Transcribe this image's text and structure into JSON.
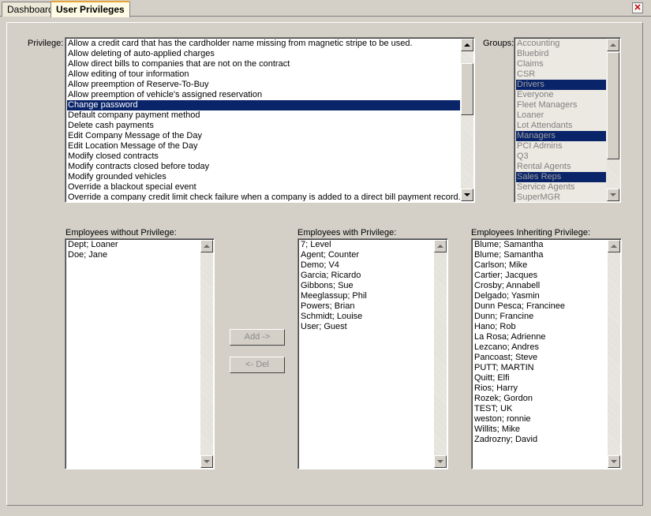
{
  "tabs": [
    {
      "label": "Dashboard",
      "active": false
    },
    {
      "label": "User Privileges",
      "active": true
    }
  ],
  "close_glyph": "✕",
  "privilege": {
    "label": "Privilege:",
    "items": [
      "Allow a credit card that has the cardholder name missing from magnetic stripe to be used.",
      "Allow deleting of auto-applied charges",
      "Allow direct bills to companies that are not on the contract",
      "Allow editing of tour information",
      "Allow preemption of Reserve-To-Buy",
      "Allow preemption of vehicle's assigned reservation",
      "Change password",
      "Default company payment method",
      "Delete cash payments",
      "Edit Company Message of the Day",
      "Edit Location Message of the Day",
      "Modify closed contracts",
      "Modify contracts closed before today",
      "Modify grounded vehicles",
      "Override a blackout special event",
      "Override a company credit limit check failure when a company is added to a direct bill payment record."
    ],
    "selected": "Change password"
  },
  "groups": {
    "label": "Groups:",
    "items": [
      "Accounting",
      "Bluebird",
      "Claims",
      "CSR",
      "Drivers",
      "Everyone",
      "Fleet Managers",
      "Loaner",
      "Lot Attendants",
      "Managers",
      "PCI Admins",
      "Q3",
      "Rental Agents",
      "Sales Reps",
      "Service Agents",
      "SuperMGR"
    ],
    "selected": [
      "Drivers",
      "Managers",
      "Sales Reps"
    ]
  },
  "without": {
    "label": "Employees without Privilege:",
    "items": [
      "Dept; Loaner",
      "Doe; Jane"
    ]
  },
  "with": {
    "label": "Employees with Privilege:",
    "items": [
      "7; Level",
      "Agent; Counter",
      "Demo; V4",
      "Garcia; Ricardo",
      "Gibbons; Sue",
      "Meeglassup; Phil",
      "Powers; Brian",
      "Schmidt; Louise",
      "User; Guest"
    ]
  },
  "inheriting": {
    "label": "Employees Inheriting Privilege:",
    "items": [
      "Blume; Samantha",
      "Blume; Samantha",
      "Carlson; Mike",
      "Cartier; Jacques",
      "Crosby; Annabell",
      "Delgado; Yasmin",
      "Dunn Pesca;  Francinee",
      "Dunn; Francine",
      "Hano; Rob",
      "La Rosa; Adrienne",
      "Lezcano; Andres",
      "Pancoast; Steve",
      "PUTT; MARTIN",
      "Quitt; Elfi",
      "Rios; Harry",
      "Rozek; Gordon",
      "TEST; UK",
      "weston; ronnie",
      "Willits; Mike",
      "Zadrozny; David"
    ]
  },
  "buttons": {
    "add": "Add ->",
    "del": "<- Del"
  }
}
